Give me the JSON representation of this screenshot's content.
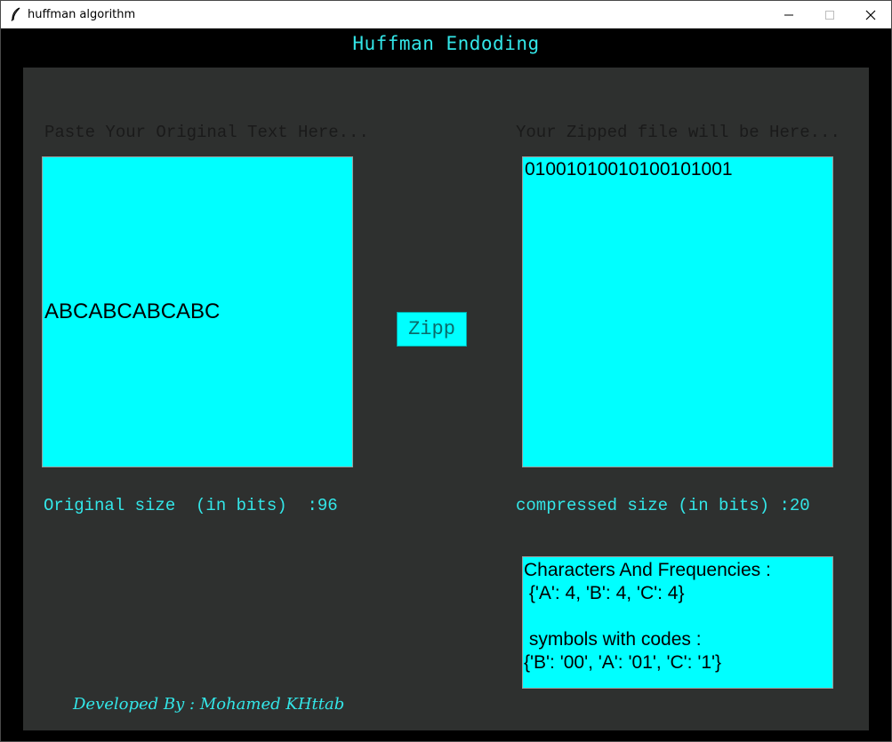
{
  "window": {
    "title": "huffman algorithm",
    "icon": "feather-icon",
    "controls": [
      "minimize-icon",
      "maximize-icon",
      "close-icon"
    ]
  },
  "app": {
    "header": "Huffman Endoding",
    "original_label": "Paste Your Original Text Here...",
    "zipped_label": "Your Zipped file will be Here...",
    "original_text": "ABCABCABCABC",
    "zipped_text": "01001010010100101001",
    "zipp_button": "Zipp",
    "original_size": "Original size  (in bits)  :96",
    "compressed_size": "compressed size (in bits) :20",
    "frequencies_text": "Characters And Frequencies :\n {'A': 4, 'B': 4, 'C': 4}\n\n symbols with codes :\n{'B': '00', 'A': '01', 'C': '1'}",
    "credit": "Developed By : Mohamed KHttab"
  },
  "colors": {
    "accent": "#33e6e8",
    "box_fill": "#00ffff",
    "panel_bg": "#2e302f",
    "window_bg": "#000000"
  }
}
